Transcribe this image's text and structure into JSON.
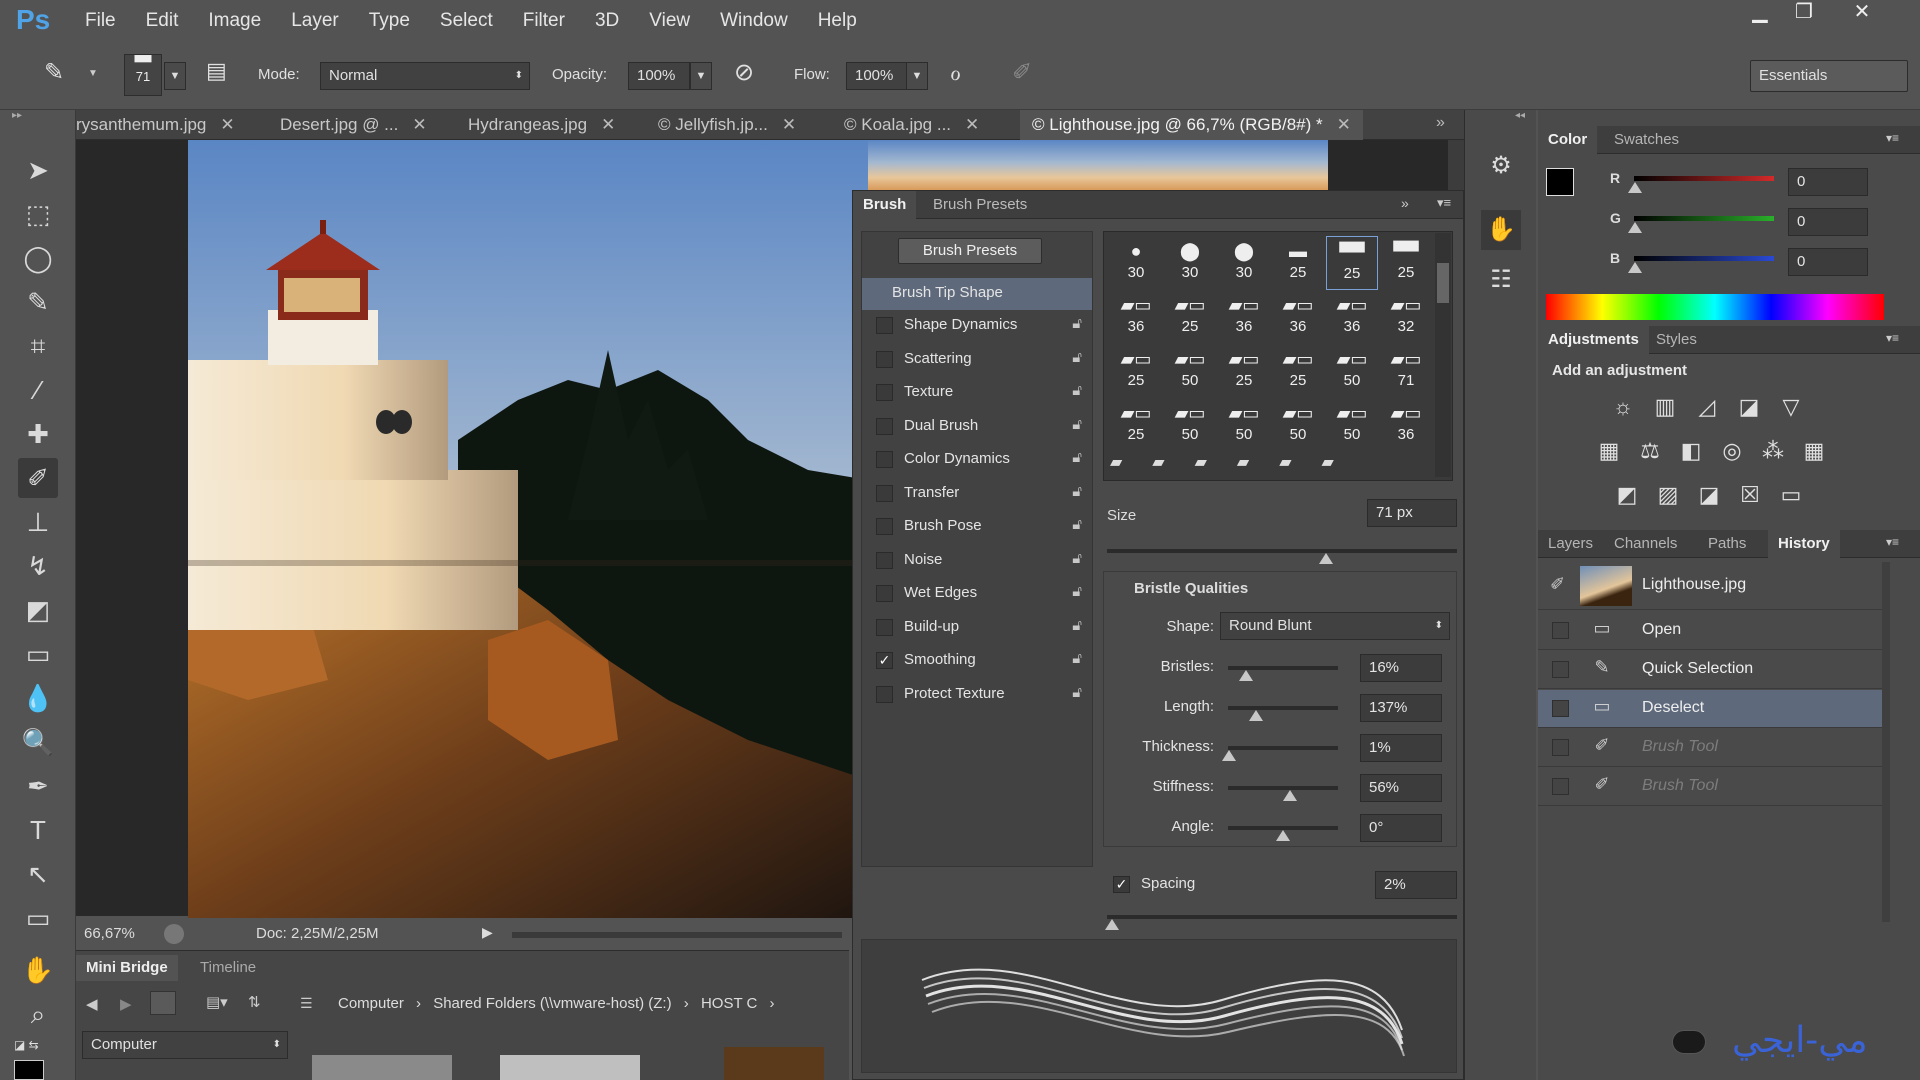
{
  "app": {
    "logo": "Ps",
    "menu": [
      "File",
      "Edit",
      "Image",
      "Layer",
      "Type",
      "Select",
      "Filter",
      "3D",
      "View",
      "Window",
      "Help"
    ]
  },
  "options": {
    "brush_size": "71",
    "mode_label": "Mode:",
    "mode_value": "Normal",
    "opacity_label": "Opacity:",
    "opacity_value": "100%",
    "flow_label": "Flow:",
    "flow_value": "100%",
    "workspace": "Essentials"
  },
  "tabs": [
    {
      "label": "rysanthemum.jpg"
    },
    {
      "label": "Desert.jpg @ ..."
    },
    {
      "label": "Hydrangeas.jpg"
    },
    {
      "label": "© Jellyfish.jp..."
    },
    {
      "label": "© Koala.jpg ..."
    },
    {
      "label": "© Lighthouse.jpg @ 66,7% (RGB/8#) *"
    }
  ],
  "status": {
    "zoom": "66,67%",
    "doc": "Doc: 2,25M/2,25M"
  },
  "minibridge": {
    "tabs": [
      "Mini Bridge",
      "Timeline"
    ],
    "path": [
      "Computer",
      "Shared Folders (\\\\vmware-host) (Z:)",
      "HOST C"
    ],
    "location": "Computer"
  },
  "brush_panel": {
    "tabs": [
      "Brush",
      "Brush Presets"
    ],
    "presets_button": "Brush Presets",
    "tip_shape": "Brush Tip Shape",
    "options": [
      {
        "label": "Shape Dynamics",
        "checked": false
      },
      {
        "label": "Scattering",
        "checked": false
      },
      {
        "label": "Texture",
        "checked": false
      },
      {
        "label": "Dual Brush",
        "checked": false
      },
      {
        "label": "Color Dynamics",
        "checked": false
      },
      {
        "label": "Transfer",
        "checked": false
      },
      {
        "label": "Brush Pose",
        "checked": false
      },
      {
        "label": "Noise",
        "checked": false
      },
      {
        "label": "Wet Edges",
        "checked": false
      },
      {
        "label": "Build-up",
        "checked": false
      },
      {
        "label": "Smoothing",
        "checked": true
      },
      {
        "label": "Protect Texture",
        "checked": false
      }
    ],
    "tip_sizes": [
      [
        "30",
        "30",
        "30",
        "25",
        "25",
        "25"
      ],
      [
        "36",
        "25",
        "36",
        "36",
        "36",
        "32"
      ],
      [
        "25",
        "50",
        "25",
        "25",
        "50",
        "71"
      ],
      [
        "25",
        "50",
        "50",
        "50",
        "50",
        "36"
      ]
    ],
    "size_label": "Size",
    "size_value": "71 px",
    "bristle_title": "Bristle Qualities",
    "shape_label": "Shape:",
    "shape_value": "Round Blunt",
    "qualities": [
      {
        "label": "Bristles:",
        "value": "16%",
        "fraction": 0.16
      },
      {
        "label": "Length:",
        "value": "137%",
        "fraction": 0.25
      },
      {
        "label": "Thickness:",
        "value": "1%",
        "fraction": 0.01
      },
      {
        "label": "Stiffness:",
        "value": "56%",
        "fraction": 0.56
      },
      {
        "label": "Angle:",
        "value": "0°",
        "fraction": 0.5
      }
    ],
    "spacing_label": "Spacing",
    "spacing_value": "2%"
  },
  "color_panel": {
    "tabs": [
      "Color",
      "Swatches"
    ],
    "channels": [
      {
        "label": "R",
        "value": "0",
        "color": "#d42a2a"
      },
      {
        "label": "G",
        "value": "0",
        "color": "#2ab02a"
      },
      {
        "label": "B",
        "value": "0",
        "color": "#2a4ad4"
      }
    ]
  },
  "adjustments": {
    "tabs": [
      "Adjustments",
      "Styles"
    ],
    "title": "Add an adjustment"
  },
  "history": {
    "tabs": [
      "Layers",
      "Channels",
      "Paths",
      "History"
    ],
    "snapshot": "Lighthouse.jpg",
    "steps": [
      {
        "label": "Open",
        "state": "normal"
      },
      {
        "label": "Quick Selection",
        "state": "normal"
      },
      {
        "label": "Deselect",
        "state": "selected"
      },
      {
        "label": "Brush Tool",
        "state": "dim"
      },
      {
        "label": "Brush Tool",
        "state": "dim"
      }
    ]
  },
  "watermark": "مي-ايجي",
  "colors": {
    "accent": "#4fa3e6",
    "selection": "#5e6a7c",
    "ui_bg": "#535353"
  }
}
